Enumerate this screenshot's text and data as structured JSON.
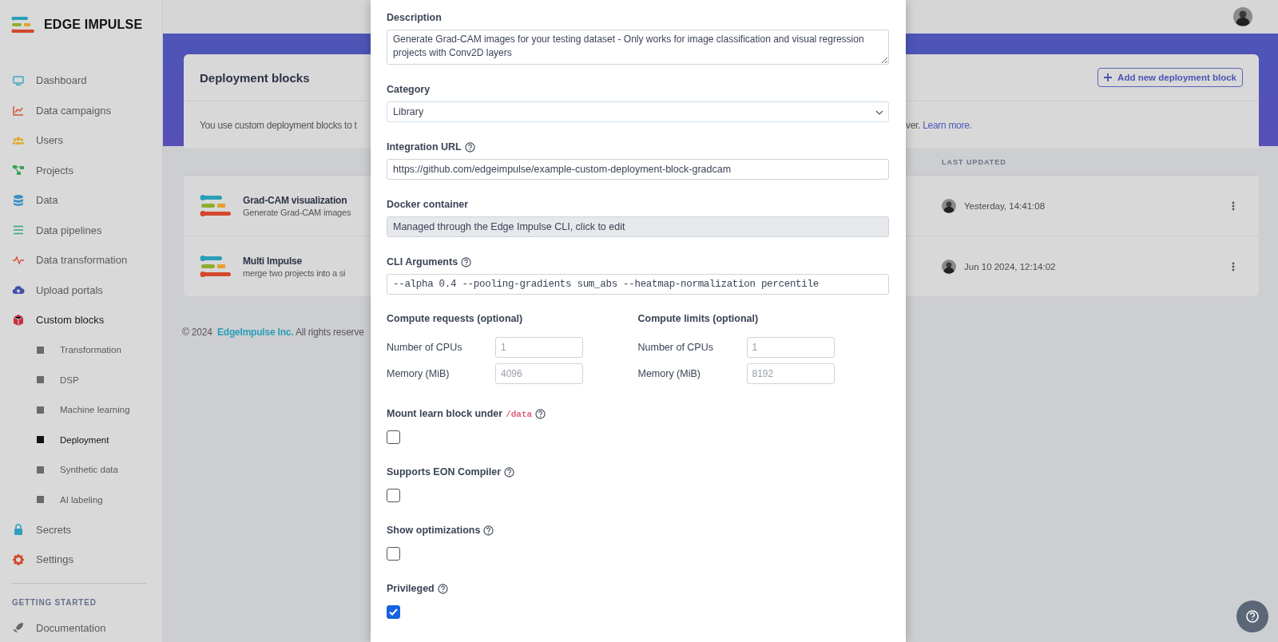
{
  "sidebar": {
    "logo": "EDGE IMPULSE",
    "items": [
      {
        "label": "Dashboard",
        "expanded": false
      },
      {
        "label": "Data campaigns",
        "expanded": false
      },
      {
        "label": "Users",
        "expanded": false
      },
      {
        "label": "Projects",
        "expanded": false
      },
      {
        "label": "Data",
        "expanded": false
      },
      {
        "label": "Data pipelines",
        "expanded": false
      },
      {
        "label": "Data transformation",
        "expanded": false
      },
      {
        "label": "Upload portals",
        "expanded": false
      },
      {
        "label": "Custom blocks",
        "expanded": true,
        "children": [
          {
            "label": "Transformation",
            "selected": false
          },
          {
            "label": "DSP",
            "selected": false
          },
          {
            "label": "Machine learning",
            "selected": false
          },
          {
            "label": "Deployment",
            "selected": true
          },
          {
            "label": "Synthetic data",
            "selected": false
          },
          {
            "label": "AI labeling",
            "selected": false
          }
        ]
      },
      {
        "label": "Secrets",
        "expanded": false
      },
      {
        "label": "Settings",
        "expanded": false
      }
    ],
    "section": "GETTING STARTED",
    "section_items": [
      {
        "label": "Documentation"
      }
    ]
  },
  "card": {
    "title": "Deployment blocks",
    "add_button": "Add new deployment block",
    "intro_start": "You use custom deployment blocks to t",
    "intro_end": "ver.",
    "intro_link": "Learn more.",
    "columns": [
      "LAST UPDATED"
    ],
    "rows": [
      {
        "name": "Grad-CAM visualization",
        "description": "Generate Grad-CAM images",
        "updated": "Yesterday, 14:41:08"
      },
      {
        "name": "Multi Impulse",
        "description": "merge two projects into a si",
        "updated": "Jun 10 2024, 12:14:02"
      }
    ]
  },
  "footer": {
    "year": "© 2024",
    "company": "EdgeImpulse Inc.",
    "rights": "All rights reserve"
  },
  "modal": {
    "fields": [
      {
        "label": "Description",
        "kind": "textarea",
        "help": false,
        "disabled": false,
        "value": "Generate Grad-CAM images for your testing dataset - Only works for image classification and visual regression projects with Conv2D layers"
      },
      {
        "label": "Category",
        "kind": "select",
        "help": false,
        "disabled": false,
        "value": "Library"
      },
      {
        "label": "Integration URL",
        "kind": "text",
        "help": true,
        "disabled": false,
        "value": "https://github.com/edgeimpulse/example-custom-deployment-block-gradcam"
      },
      {
        "label": "Docker container",
        "kind": "text",
        "help": false,
        "disabled": true,
        "value": "Managed through the Edge Impulse CLI, click to edit"
      },
      {
        "label": "CLI Arguments",
        "kind": "code",
        "help": true,
        "disabled": false,
        "value": "--alpha 0.4 --pooling-gradients sum_abs --heatmap-normalization percentile"
      }
    ],
    "compute": [
      {
        "title": "Compute requests (optional)",
        "rows": [
          {
            "label": "Number of CPUs",
            "placeholder": "1"
          },
          {
            "label": "Memory (MiB)",
            "placeholder": "4096"
          }
        ]
      },
      {
        "title": "Compute limits (optional)",
        "rows": [
          {
            "label": "Number of CPUs",
            "placeholder": "1"
          },
          {
            "label": "Memory (MiB)",
            "placeholder": "8192"
          }
        ]
      }
    ],
    "toggles": [
      {
        "label": "Mount learn block under",
        "code": "/data",
        "help": true,
        "checked": false
      },
      {
        "label": "Supports EON Compiler",
        "help": true,
        "checked": false
      },
      {
        "label": "Show optimizations",
        "help": true,
        "checked": false
      },
      {
        "label": "Privileged",
        "help": true,
        "checked": true
      }
    ]
  }
}
